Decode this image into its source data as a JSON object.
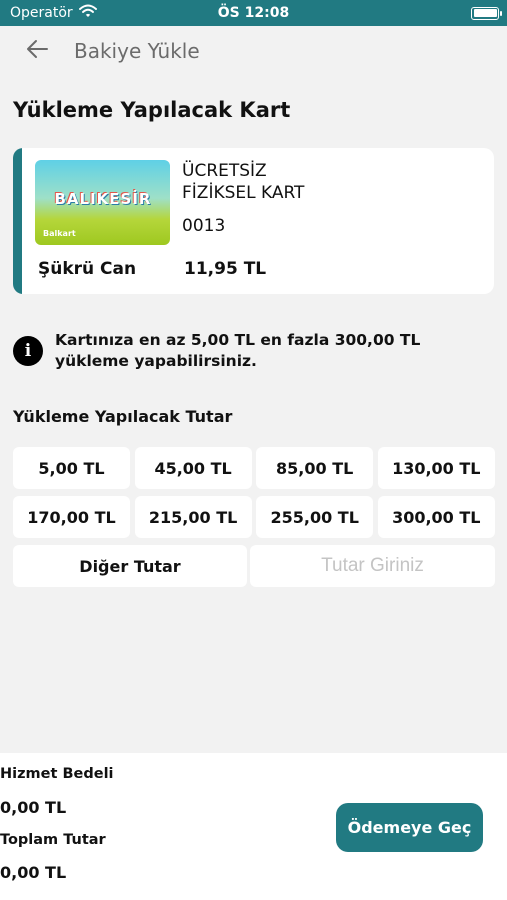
{
  "status_bar": {
    "carrier": "Operatör",
    "time": "ÖS 12:08",
    "wifi_icon": "wifi-icon",
    "battery_icon": "battery-icon"
  },
  "nav": {
    "back_icon": "arrow-left-icon",
    "title": "Bakiye Yükle"
  },
  "card_section": {
    "title": "Yükleme Yapılacak Kart",
    "card": {
      "image_brand_text": "BALIKESİR",
      "image_card_name": "Balkart",
      "type_line1": "ÜCRETSİZ",
      "type_line2": "FİZİKSEL KART",
      "number": "0013",
      "owner": "Şükrü Can",
      "balance": "11,95 TL"
    }
  },
  "info": {
    "icon": "info-icon",
    "text": "Kartınıza en az 5,00 TL en fazla 300,00 TL yükleme yapabilirsiniz."
  },
  "amounts": {
    "label": "Yükleme Yapılacak Tutar",
    "options": [
      "5,00 TL",
      "45,00 TL",
      "85,00 TL",
      "130,00 TL",
      "170,00 TL",
      "215,00 TL",
      "255,00 TL",
      "300,00 TL"
    ],
    "other_label": "Diğer Tutar",
    "input_placeholder": "Tutar Giriniz",
    "input_value": ""
  },
  "summary": {
    "service_fee_label": "Hizmet Bedeli",
    "service_fee_value": "0,00 TL",
    "total_label": "Toplam Tutar",
    "total_value": "0,00 TL",
    "pay_button": "Ödemeye Geç"
  },
  "colors": {
    "accent": "#217a82",
    "background": "#f2f2f2"
  }
}
